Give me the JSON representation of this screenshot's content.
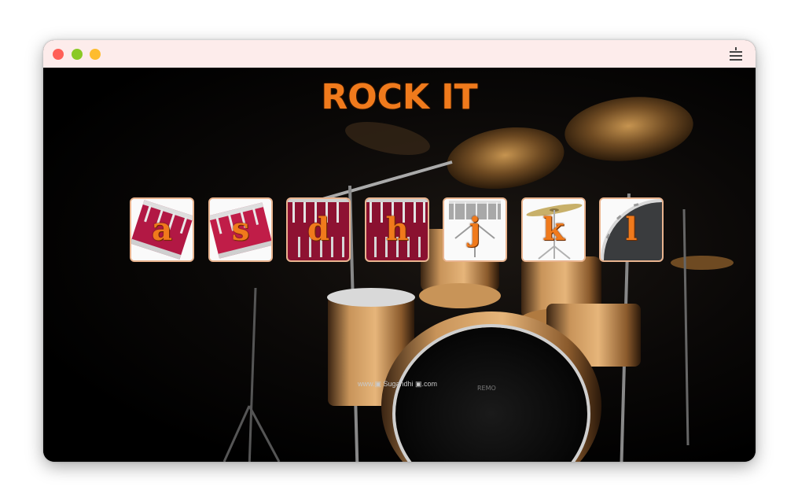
{
  "window": {
    "controls": {
      "close_color": "#ff5f57",
      "minimize_color": "#febc2e",
      "zoom_color": "#8ac926"
    },
    "menu_icon": "hamburger-menu-icon"
  },
  "app": {
    "title": "ROCK IT",
    "watermark": "www.▣ Sugandhi ▣.com"
  },
  "drum_keys": [
    {
      "letter": "a",
      "sound": "tom-1",
      "art": "red-drum-tilted"
    },
    {
      "letter": "s",
      "sound": "tom-2",
      "art": "red-drum-tilted"
    },
    {
      "letter": "d",
      "sound": "tom-3",
      "art": "red-drum"
    },
    {
      "letter": "h",
      "sound": "tom-4",
      "art": "red-drum"
    },
    {
      "letter": "j",
      "sound": "snare",
      "art": "snare-drum"
    },
    {
      "letter": "k",
      "sound": "crash",
      "art": "cymbal"
    },
    {
      "letter": "l",
      "sound": "kick-bass",
      "art": "bass-drum"
    }
  ],
  "colors": {
    "accent": "#f07a1c",
    "key_border": "#e9b48f",
    "titlebar": "#fdeceb"
  }
}
